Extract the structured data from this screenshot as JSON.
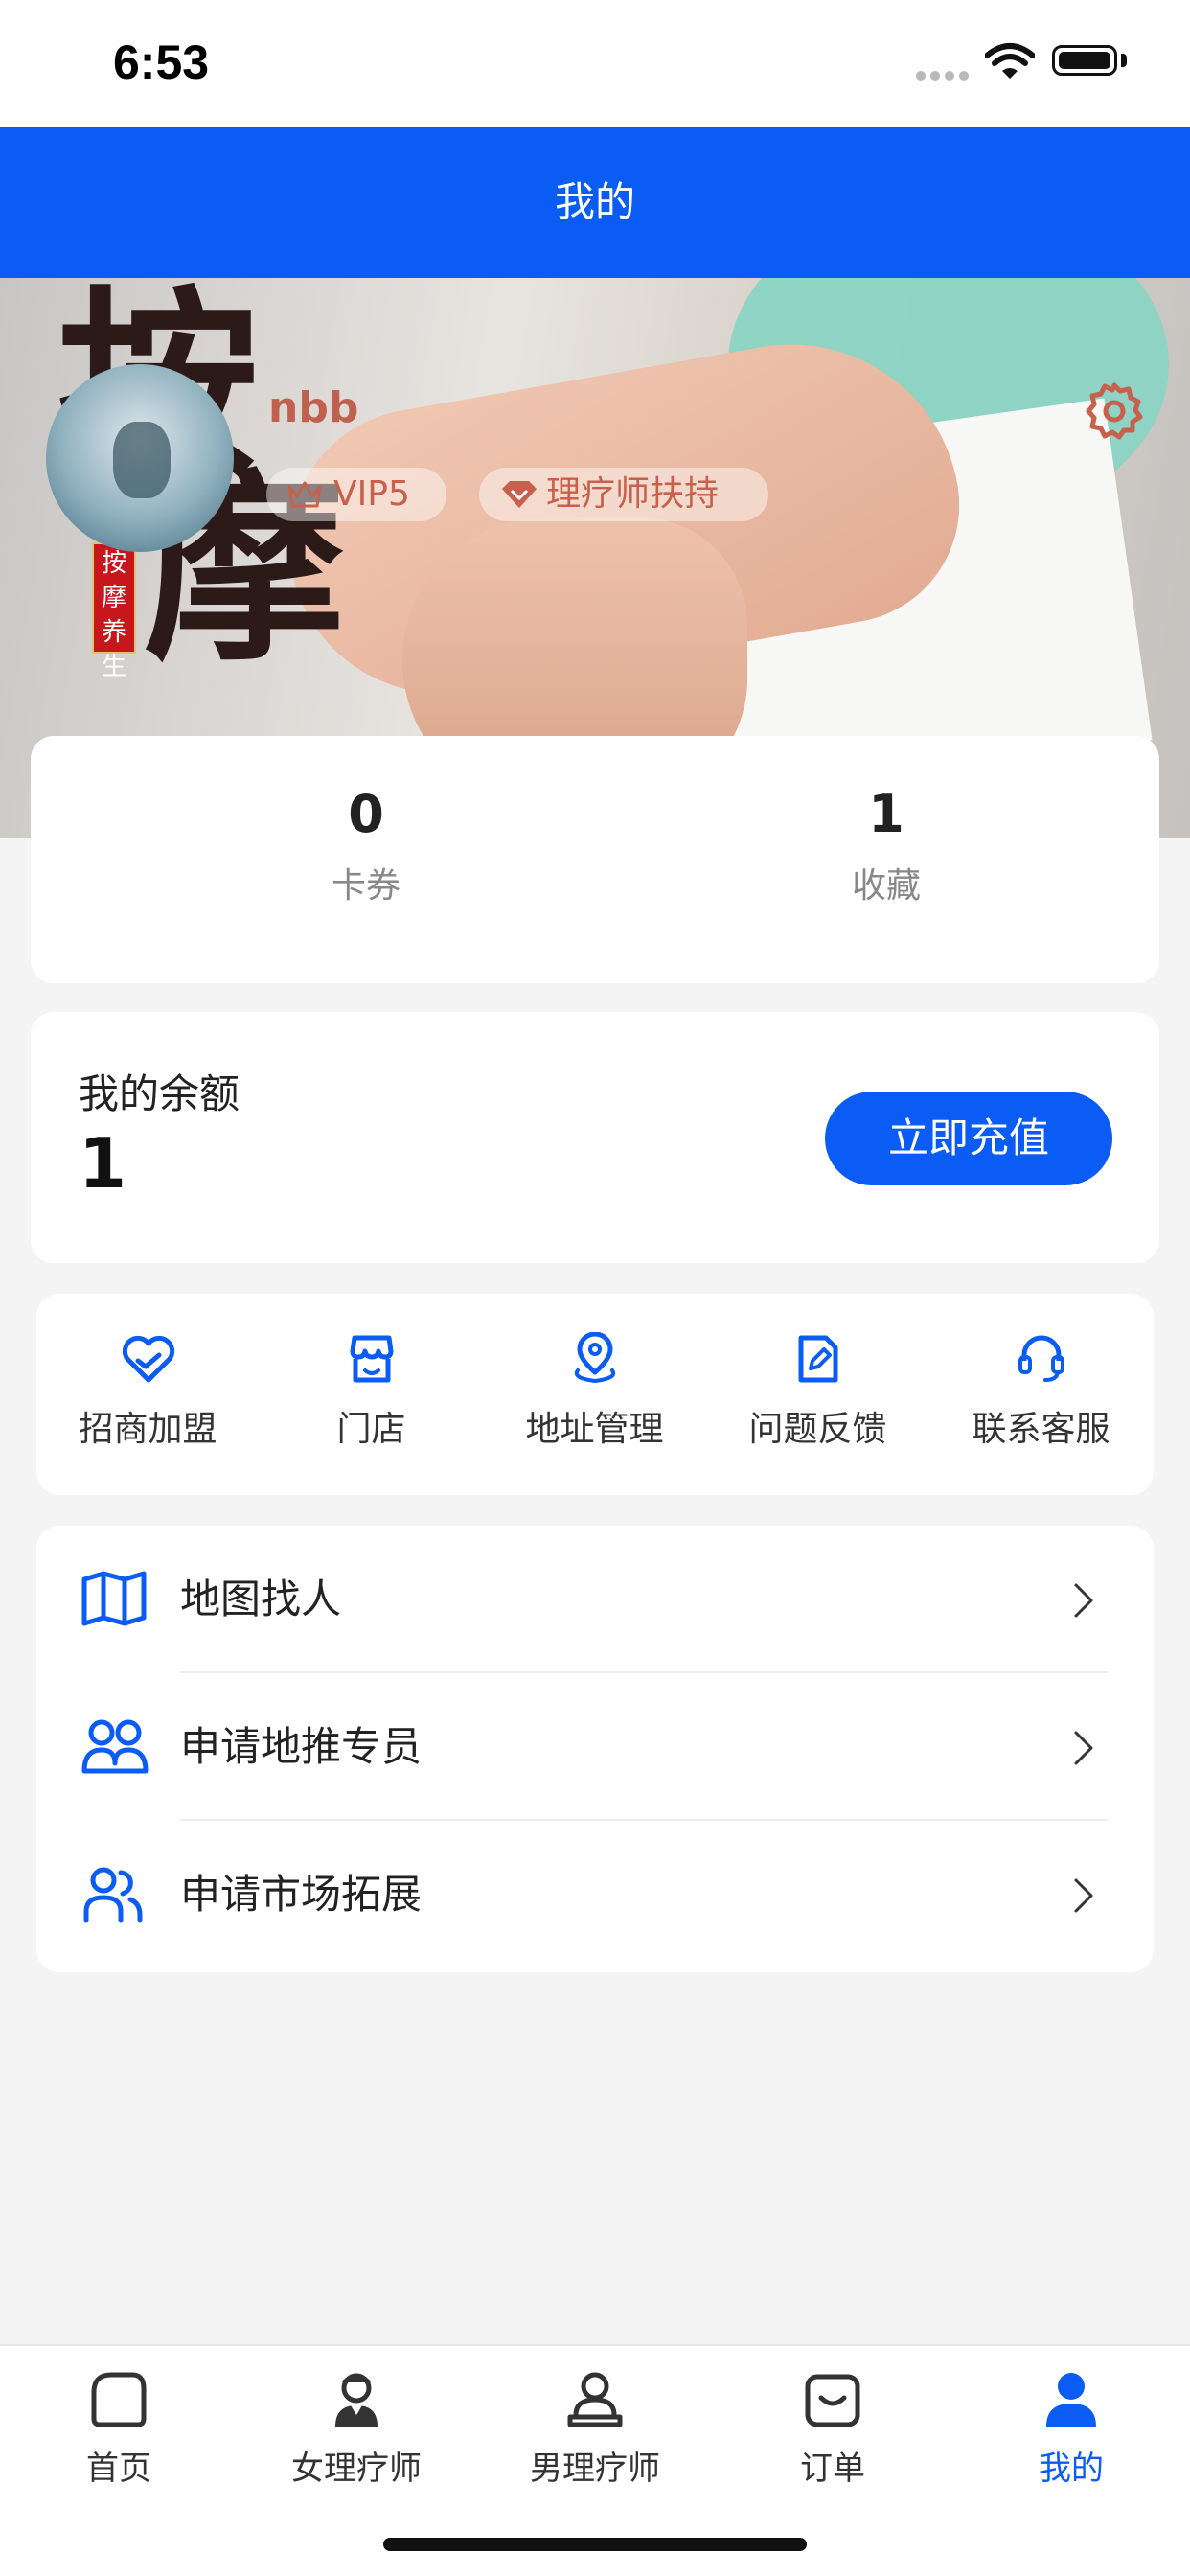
{
  "status_bar": {
    "time": "6:53"
  },
  "header": {
    "title": "我的"
  },
  "profile": {
    "username": "nbb",
    "badges": {
      "vip": "VIP5",
      "support": "理疗师扶持"
    },
    "banner_seal": "按摩养生",
    "banner_calligraphy": [
      "按",
      "摩"
    ]
  },
  "stats": [
    {
      "value": "0",
      "label": "卡券"
    },
    {
      "value": "1",
      "label": "收藏"
    }
  ],
  "balance": {
    "label": "我的余额",
    "value": "1",
    "recharge_label": "立即充值"
  },
  "quick_actions": [
    {
      "label": "招商加盟",
      "icon": "heart-handshake-icon"
    },
    {
      "label": "门店",
      "icon": "store-icon"
    },
    {
      "label": "地址管理",
      "icon": "location-pin-icon"
    },
    {
      "label": "问题反馈",
      "icon": "edit-document-icon"
    },
    {
      "label": "联系客服",
      "icon": "headset-icon"
    }
  ],
  "menu": [
    {
      "label": "地图找人",
      "icon": "map-icon"
    },
    {
      "label": "申请地推专员",
      "icon": "users-icon"
    },
    {
      "label": "申请市场拓展",
      "icon": "user-group-icon"
    }
  ],
  "tabs": [
    {
      "label": "首页",
      "icon": "home-icon"
    },
    {
      "label": "女理疗师",
      "icon": "female-therapist-icon"
    },
    {
      "label": "男理疗师",
      "icon": "male-therapist-icon"
    },
    {
      "label": "订单",
      "icon": "order-icon"
    },
    {
      "label": "我的",
      "icon": "profile-icon",
      "active": true
    }
  ],
  "colors": {
    "primary": "#0a5cf5",
    "accent": "#c7604c",
    "background": "#f4f4f4"
  }
}
